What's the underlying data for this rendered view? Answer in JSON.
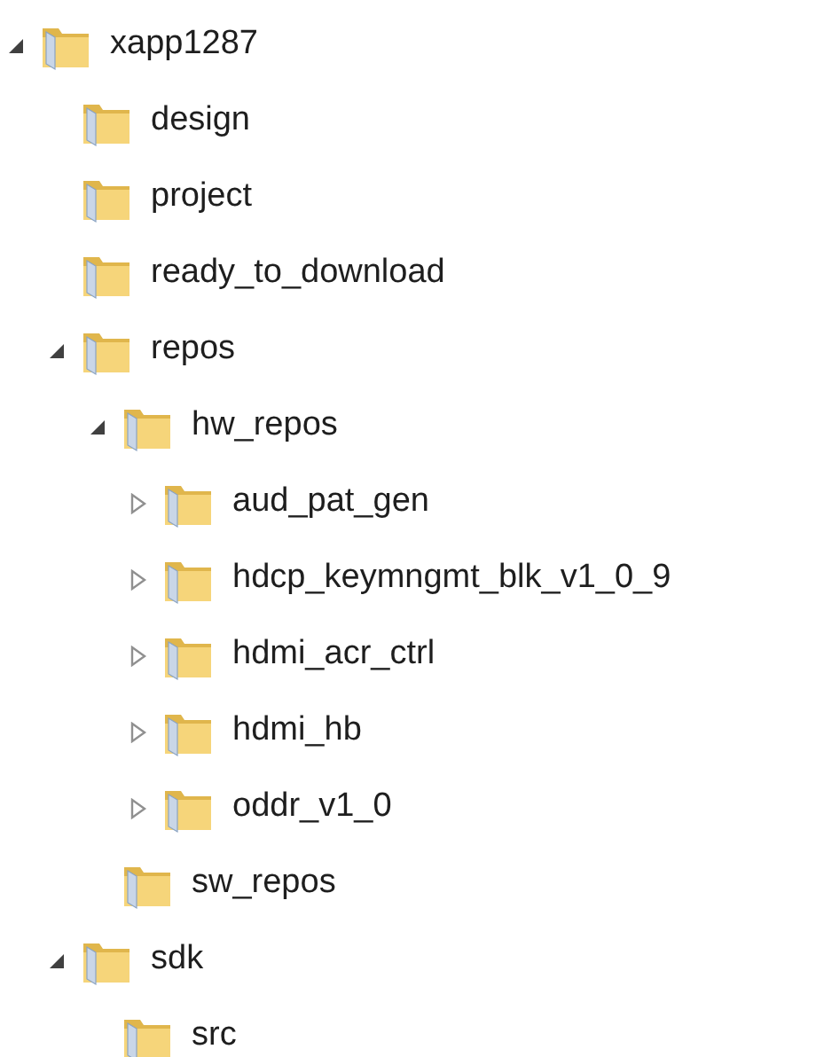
{
  "tree": [
    {
      "name": "xapp1287",
      "expanded": true,
      "children": [
        {
          "name": "design"
        },
        {
          "name": "project"
        },
        {
          "name": "ready_to_download"
        },
        {
          "name": "repos",
          "expanded": true,
          "children": [
            {
              "name": "hw_repos",
              "expanded": true,
              "children": [
                {
                  "name": "aud_pat_gen",
                  "expanded": false
                },
                {
                  "name": "hdcp_keymngmt_blk_v1_0_9",
                  "expanded": false
                },
                {
                  "name": "hdmi_acr_ctrl",
                  "expanded": false
                },
                {
                  "name": "hdmi_hb",
                  "expanded": false
                },
                {
                  "name": "oddr_v1_0",
                  "expanded": false
                }
              ]
            },
            {
              "name": "sw_repos"
            }
          ]
        },
        {
          "name": "sdk",
          "expanded": true,
          "children": [
            {
              "name": "src"
            }
          ]
        }
      ]
    }
  ]
}
